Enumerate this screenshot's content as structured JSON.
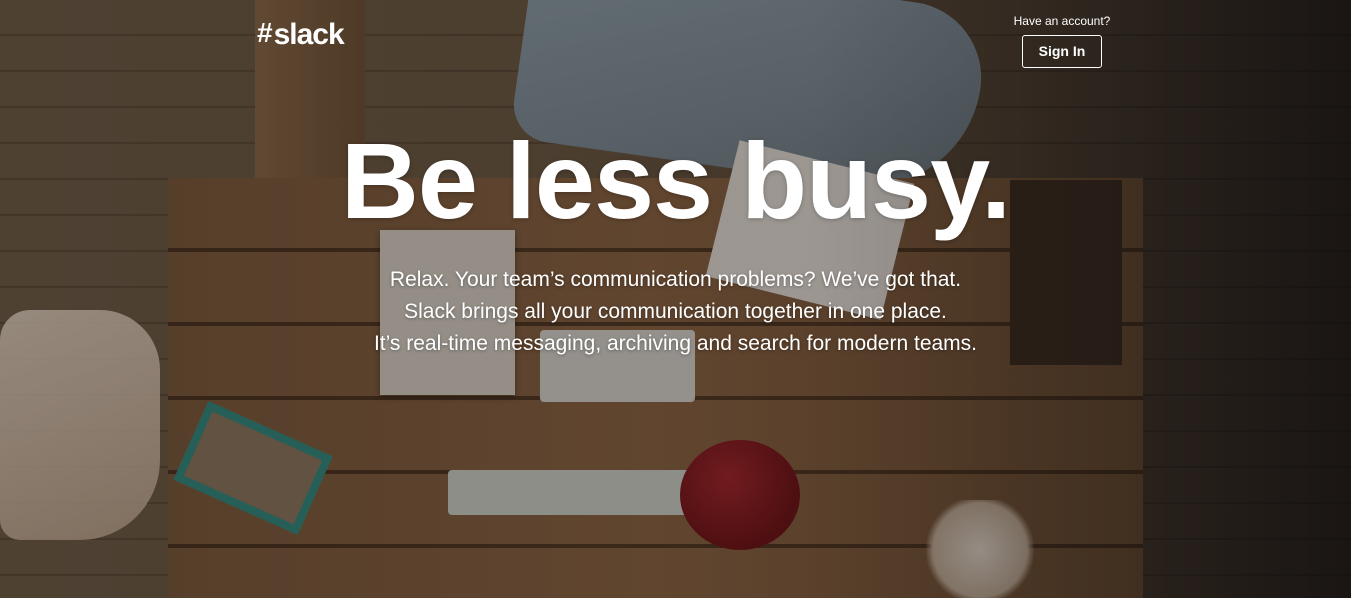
{
  "header": {
    "logo_mark": "#",
    "logo_text": "slack",
    "account_prompt": "Have an account?",
    "signin_label": "Sign In"
  },
  "hero": {
    "headline": "Be less busy.",
    "tagline_lines": [
      "Relax. Your team’s communication problems? We’ve got that.",
      "Slack brings all your communication together in one place.",
      "It’s real-time messaging, archiving and search for modern teams."
    ]
  },
  "colors": {
    "text": "#ffffff",
    "overlay": "#140c06"
  },
  "icons": {
    "logo": "slack-hash-logo-icon"
  }
}
